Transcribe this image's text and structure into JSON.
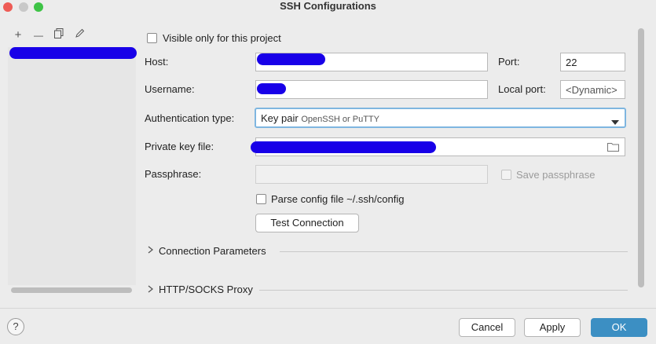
{
  "window": {
    "title": "SSH Configurations"
  },
  "colors": {
    "accent": "#3c8fc3",
    "redaction": "#1800e8"
  },
  "toolbar": {
    "icons": [
      "add-icon",
      "remove-icon",
      "copy-icon",
      "edit-icon"
    ],
    "add_glyph": "+",
    "remove_glyph": "—"
  },
  "form": {
    "visible_only_label": "Visible only for this project",
    "host_label": "Host:",
    "port_label": "Port:",
    "port_value": "22",
    "username_label": "Username:",
    "local_port_label": "Local port:",
    "local_port_placeholder": "<Dynamic>",
    "auth_type_label": "Authentication type:",
    "auth_type_value": "Key pair",
    "auth_type_hint": "OpenSSH or PuTTY",
    "private_key_label": "Private key file:",
    "passphrase_label": "Passphrase:",
    "save_passphrase_label": "Save passphrase",
    "parse_config_label": "Parse config file ~/.ssh/config",
    "test_connection_label": "Test Connection"
  },
  "sections": {
    "connection_parameters": "Connection Parameters",
    "proxy": "HTTP/SOCKS Proxy"
  },
  "footer": {
    "help_glyph": "?",
    "cancel_label": "Cancel",
    "apply_label": "Apply",
    "ok_label": "OK"
  }
}
